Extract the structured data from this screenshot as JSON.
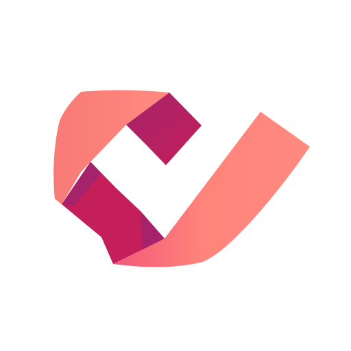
{
  "logo": {
    "icon": "ribbon-checkmark-logo-icon",
    "colors": {
      "coral": "#FF847A",
      "coral_light": "#FF8A80",
      "salmon": "#F87A76",
      "pink": "#F2587A",
      "magenta": "#C41F5A",
      "magenta_dark": "#B01E5C",
      "plum": "#A5236A",
      "background": "#FFFFFF"
    }
  }
}
